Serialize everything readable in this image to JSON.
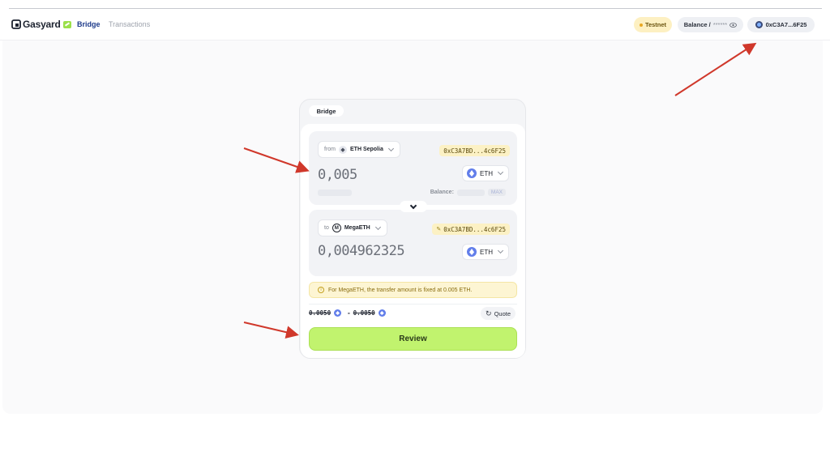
{
  "header": {
    "logo_text": "Gasyard",
    "nav": {
      "bridge": "Bridge",
      "transactions": "Transactions"
    },
    "testnet_label": "Testnet",
    "balance_label": "Balance /",
    "balance_masked": "******",
    "wallet_address": "0xC3A7...6F25"
  },
  "card": {
    "tab_label": "Bridge",
    "from": {
      "prefix": "from",
      "network": "ETH Sepolia",
      "address": "0xC3A7BD...4c6F25",
      "amount": "0,005",
      "token": "ETH",
      "balance_label": "Balance:",
      "max_label": "MAX"
    },
    "to": {
      "prefix": "to",
      "network": "MegaETH",
      "network_icon_letter": "M",
      "address": "0xC3A7BD...4c6F25",
      "amount": "0,004962325",
      "token": "ETH"
    },
    "notice": "For MegaETH, the transfer amount is fixed at 0.005 ETH.",
    "quote": {
      "from_value": "0.0050",
      "separator": "-",
      "to_value": "0.0050",
      "button_label": "Quote"
    },
    "review_label": "Review"
  },
  "colors": {
    "review_green": "#c1f36e",
    "testnet_bg": "#fdf0c2",
    "eth_blue": "#627eea",
    "annotation_red": "#d0382b"
  },
  "icons": [
    "gasyard-logo-icon",
    "eye-icon",
    "wallet-globe-icon",
    "eth-icon",
    "megaeth-icon",
    "chevron-down-icon",
    "pencil-icon",
    "info-icon",
    "refresh-icon"
  ]
}
